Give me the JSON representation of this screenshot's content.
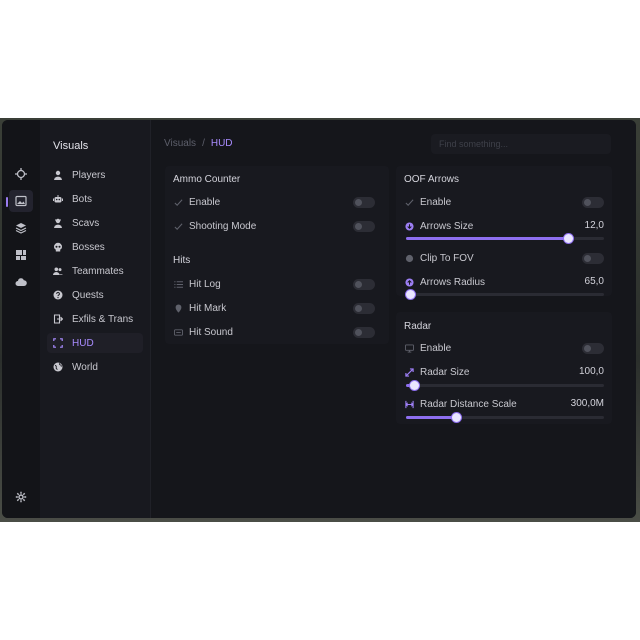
{
  "nav": {
    "title": "Visuals",
    "items": [
      {
        "label": "Players",
        "icon": "user-icon"
      },
      {
        "label": "Bots",
        "icon": "robot-icon"
      },
      {
        "label": "Scavs",
        "icon": "scav-icon"
      },
      {
        "label": "Bosses",
        "icon": "skull-icon"
      },
      {
        "label": "Teammates",
        "icon": "group-icon"
      },
      {
        "label": "Quests",
        "icon": "question-icon"
      },
      {
        "label": "Exfils & Trans",
        "icon": "exit-icon"
      },
      {
        "label": "HUD",
        "icon": "frame-icon",
        "active": true
      },
      {
        "label": "World",
        "icon": "globe-icon"
      }
    ]
  },
  "rail": [
    "crosshair-icon",
    "image-icon",
    "layers-icon",
    "dashboard-icon",
    "cloud-icon",
    "settings-icon"
  ],
  "breadcrumb": {
    "root": "Visuals",
    "separator": "/",
    "current": "HUD"
  },
  "search": {
    "placeholder": "Find something..."
  },
  "ammo": {
    "title": "Ammo Counter",
    "rows": [
      {
        "label": "Enable",
        "on": false
      },
      {
        "label": "Shooting Mode",
        "on": false
      }
    ]
  },
  "hits": {
    "title": "Hits",
    "rows": [
      {
        "label": "Hit Log",
        "on": false
      },
      {
        "label": "Hit Mark",
        "on": false
      },
      {
        "label": "Hit Sound",
        "on": false
      }
    ]
  },
  "oof": {
    "title": "OOF Arrows",
    "enable_label": "Enable",
    "arrows_size": {
      "label": "Arrows Size",
      "value": "12,0",
      "fraction": 0.82
    },
    "clip_label": "Clip To FOV",
    "arrows_radius": {
      "label": "Arrows Radius",
      "value": "65,0",
      "fraction": 0.02
    }
  },
  "radar": {
    "title": "Radar",
    "enable_label": "Enable",
    "size": {
      "label": "Radar Size",
      "value": "100,0",
      "fraction": 0.04
    },
    "distance": {
      "label": "Radar Distance Scale",
      "value": "300,0M",
      "fraction": 0.25
    }
  },
  "colors": {
    "accent": "#8e6ff0",
    "active_text": "#a98cff",
    "background": "#16171c"
  }
}
